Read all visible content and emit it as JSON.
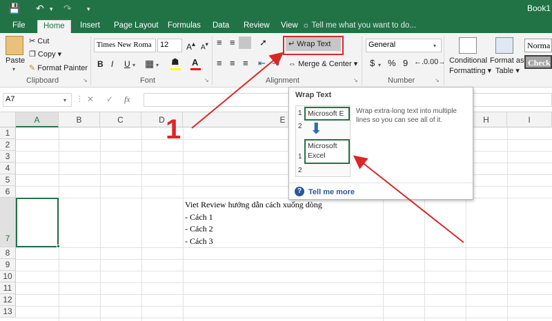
{
  "titlebar": {
    "book": "Book1"
  },
  "tabs": [
    "File",
    "Home",
    "Insert",
    "Page Layout",
    "Formulas",
    "Data",
    "Review",
    "View"
  ],
  "tell_me": "Tell me what you want to do...",
  "clipboard": {
    "paste": "Paste",
    "cut": "Cut",
    "copy": "Copy",
    "format_painter": "Format Painter",
    "label": "Clipboard"
  },
  "font": {
    "name": "Times New Roma",
    "size": "12",
    "bold": "B",
    "italic": "I",
    "underline": "U",
    "label": "Font"
  },
  "alignment": {
    "wrap_text": "Wrap Text",
    "merge_center": "Merge & Center",
    "label": "Alignment"
  },
  "number": {
    "format": "General",
    "currency": "$",
    "percent": "%",
    "comma": "9",
    "label": "Number"
  },
  "styles": {
    "conditional": "Conditional",
    "formatting": "Formatting",
    "format_as": "Format as",
    "table": "Table",
    "normal": "Norma",
    "check": "Check"
  },
  "namebox": "A7",
  "formula_fx": "fx",
  "columns": [
    "A",
    "B",
    "C",
    "D",
    "E",
    "",
    "",
    "H",
    "I"
  ],
  "rows": [
    "1",
    "2",
    "3",
    "4",
    "5",
    "6",
    "7",
    "8",
    "9",
    "10",
    "11",
    "12",
    "13"
  ],
  "cell_e7": [
    "Viet Review hướng dẫn cách xuống dòng",
    "- Cách 1",
    "- Cách 2",
    "- Cách 3"
  ],
  "popup": {
    "title": "Wrap Text",
    "description": "Wrap extra-long text into multiple lines so you can see all of it.",
    "before_text": "Microsoft E",
    "after_line1": "Microsoft",
    "after_line2": "Excel",
    "row1": "1",
    "row2": "2",
    "tell_me_more": "Tell me more"
  },
  "annotation": "1",
  "colors": {
    "excel_green": "#217346",
    "annotation_red": "#d92727",
    "link_blue": "#2b579a"
  }
}
